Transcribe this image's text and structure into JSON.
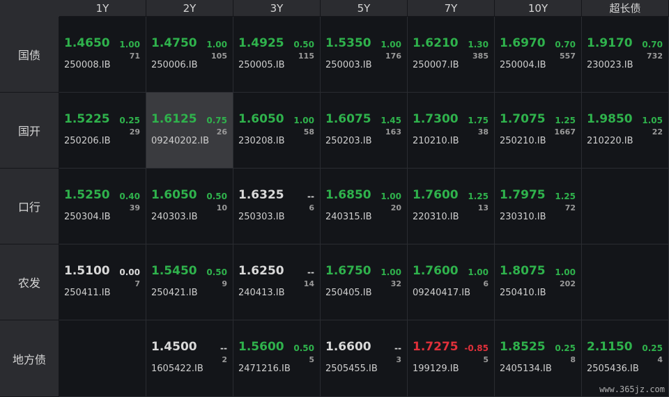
{
  "columns": [
    "1Y",
    "2Y",
    "3Y",
    "5Y",
    "7Y",
    "10Y",
    "超长债"
  ],
  "rows": [
    {
      "label": "国债",
      "cells": [
        {
          "price": "1.4650",
          "change": "1.00",
          "volume": "71",
          "code": "250008.IB",
          "price_color": "g",
          "change_color": "g"
        },
        {
          "price": "1.4750",
          "change": "1.00",
          "volume": "105",
          "code": "250006.IB",
          "price_color": "g",
          "change_color": "g"
        },
        {
          "price": "1.4925",
          "change": "0.50",
          "volume": "115",
          "code": "250005.IB",
          "price_color": "g",
          "change_color": "g"
        },
        {
          "price": "1.5350",
          "change": "1.00",
          "volume": "176",
          "code": "250003.IB",
          "price_color": "g",
          "change_color": "g"
        },
        {
          "price": "1.6210",
          "change": "1.30",
          "volume": "385",
          "code": "250007.IB",
          "price_color": "g",
          "change_color": "g"
        },
        {
          "price": "1.6970",
          "change": "0.70",
          "volume": "557",
          "code": "250004.IB",
          "price_color": "g",
          "change_color": "g"
        },
        {
          "price": "1.9170",
          "change": "0.70",
          "volume": "732",
          "code": "230023.IB",
          "price_color": "g",
          "change_color": "g"
        }
      ]
    },
    {
      "label": "国开",
      "cells": [
        {
          "price": "1.5225",
          "change": "0.25",
          "volume": "29",
          "code": "250206.IB",
          "price_color": "g",
          "change_color": "g"
        },
        {
          "price": "1.6125",
          "change": "0.75",
          "volume": "26",
          "code": "09240202.IB",
          "price_color": "g",
          "change_color": "g",
          "selected": true
        },
        {
          "price": "1.6050",
          "change": "1.00",
          "volume": "58",
          "code": "230208.IB",
          "price_color": "g",
          "change_color": "g"
        },
        {
          "price": "1.6075",
          "change": "1.45",
          "volume": "163",
          "code": "250203.IB",
          "price_color": "g",
          "change_color": "g"
        },
        {
          "price": "1.7300",
          "change": "1.75",
          "volume": "38",
          "code": "210210.IB",
          "price_color": "g",
          "change_color": "g"
        },
        {
          "price": "1.7075",
          "change": "1.25",
          "volume": "1667",
          "code": "250210.IB",
          "price_color": "g",
          "change_color": "g"
        },
        {
          "price": "1.9850",
          "change": "1.05",
          "volume": "22",
          "code": "210220.IB",
          "price_color": "g",
          "change_color": "g"
        }
      ]
    },
    {
      "label": "口行",
      "cells": [
        {
          "price": "1.5250",
          "change": "0.40",
          "volume": "39",
          "code": "250304.IB",
          "price_color": "g",
          "change_color": "g"
        },
        {
          "price": "1.6050",
          "change": "0.50",
          "volume": "10",
          "code": "240303.IB",
          "price_color": "g",
          "change_color": "g"
        },
        {
          "price": "1.6325",
          "change": "--",
          "volume": "6",
          "code": "250303.IB",
          "price_color": "w",
          "change_color": "w"
        },
        {
          "price": "1.6850",
          "change": "1.00",
          "volume": "20",
          "code": "240315.IB",
          "price_color": "g",
          "change_color": "g"
        },
        {
          "price": "1.7600",
          "change": "1.25",
          "volume": "13",
          "code": "220310.IB",
          "price_color": "g",
          "change_color": "g"
        },
        {
          "price": "1.7975",
          "change": "1.25",
          "volume": "72",
          "code": "230310.IB",
          "price_color": "g",
          "change_color": "g"
        },
        null
      ]
    },
    {
      "label": "农发",
      "cells": [
        {
          "price": "1.5100",
          "change": "0.00",
          "volume": "7",
          "code": "250411.IB",
          "price_color": "w",
          "change_color": "w"
        },
        {
          "price": "1.5450",
          "change": "0.50",
          "volume": "9",
          "code": "250421.IB",
          "price_color": "g",
          "change_color": "g"
        },
        {
          "price": "1.6250",
          "change": "--",
          "volume": "14",
          "code": "240413.IB",
          "price_color": "w",
          "change_color": "w"
        },
        {
          "price": "1.6750",
          "change": "1.00",
          "volume": "32",
          "code": "250405.IB",
          "price_color": "g",
          "change_color": "g"
        },
        {
          "price": "1.7600",
          "change": "1.00",
          "volume": "6",
          "code": "09240417.IB",
          "price_color": "g",
          "change_color": "g"
        },
        {
          "price": "1.8075",
          "change": "1.00",
          "volume": "202",
          "code": "250410.IB",
          "price_color": "g",
          "change_color": "g"
        },
        null
      ]
    },
    {
      "label": "地方债",
      "cells": [
        null,
        {
          "price": "1.4500",
          "change": "--",
          "volume": "2",
          "code": "1605422.IB",
          "price_color": "w",
          "change_color": "w"
        },
        {
          "price": "1.5600",
          "change": "0.50",
          "volume": "5",
          "code": "2471216.IB",
          "price_color": "g",
          "change_color": "g"
        },
        {
          "price": "1.6600",
          "change": "--",
          "volume": "3",
          "code": "2505455.IB",
          "price_color": "w",
          "change_color": "w"
        },
        {
          "price": "1.7275",
          "change": "-0.85",
          "volume": "5",
          "code": "199129.IB",
          "price_color": "r",
          "change_color": "r"
        },
        {
          "price": "1.8525",
          "change": "0.25",
          "volume": "8",
          "code": "2405134.IB",
          "price_color": "g",
          "change_color": "g"
        },
        {
          "price": "2.1150",
          "change": "0.25",
          "volume": "4",
          "code": "2505436.IB",
          "price_color": "g",
          "change_color": "g"
        }
      ]
    }
  ],
  "watermark": "www.365jz.com",
  "colors": {
    "up": "#2fb24c",
    "flat": "#d9d9d9",
    "down": "#e0303a",
    "background": "#131519",
    "header": "#2b2c30",
    "selected": "#3a3b3f"
  }
}
